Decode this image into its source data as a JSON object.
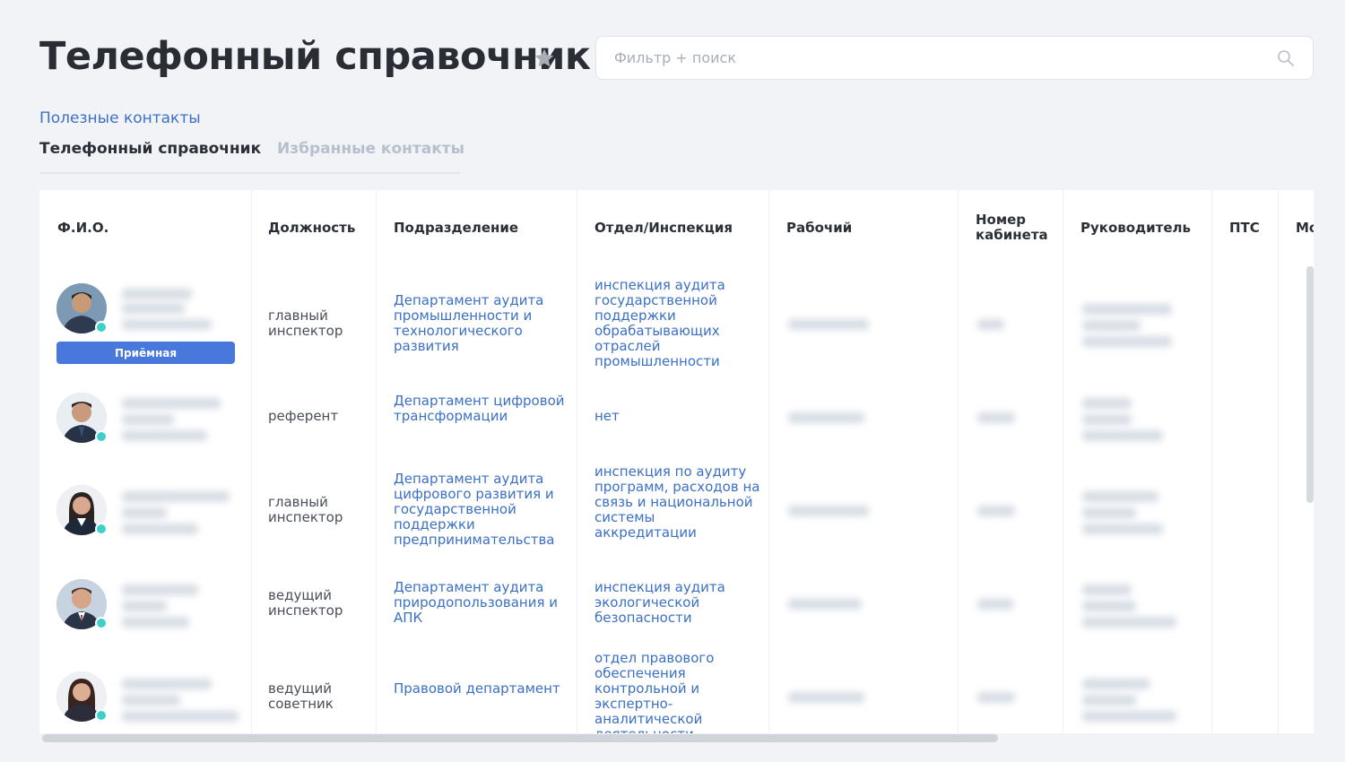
{
  "header": {
    "title": "Телефонный справочник",
    "search_placeholder": "Фильтр + поиск"
  },
  "nav": {
    "useful_link": "Полезные контакты",
    "tabs": [
      {
        "label": "Телефонный справочник",
        "active": true
      },
      {
        "label": "Избранные контакты",
        "active": false
      }
    ]
  },
  "table": {
    "columns": {
      "fio": "Ф.И.О.",
      "position": "Должность",
      "division": "Подразделение",
      "department": "Отдел/Инспекция",
      "work_phone": "Рабочий",
      "room_line1": "Номер",
      "room_line2": "кабинета",
      "manager": "Руководитель",
      "pts": "ПТС",
      "mobile_partial": "Мо"
    },
    "rows": [
      {
        "badge": "Приёмная",
        "position": "главный инспектор",
        "division": "Департамент аудита промышленности и технологического развития",
        "department": "инспекция аудита государственной поддержки обрабатывающих отраслей промышленности"
      },
      {
        "position": "референт",
        "division": "Департамент цифровой трансформации",
        "department": "нет"
      },
      {
        "position": "главный инспектор",
        "division": "Департамент аудита цифрового развития и государственной поддержки предпринимательства",
        "department": "инспекция по аудиту программ, расходов на связь и национальной системы аккредитации"
      },
      {
        "position": "ведущий инспектор",
        "division": "Департамент аудита природопользования и АПК",
        "department": "инспекция аудита экологической безопасности"
      },
      {
        "position": "ведущий советник",
        "division": "Правовой департамент",
        "department": "отдел правового обеспечения контрольной и экспертно-аналитической деятельности"
      }
    ]
  },
  "colors": {
    "accent": "#3b70c4",
    "badge": "#4878dc",
    "online": "#3fd0c9",
    "background": "#f2f3f7"
  },
  "icons": {
    "favorite": "star-icon",
    "search": "search-icon"
  }
}
